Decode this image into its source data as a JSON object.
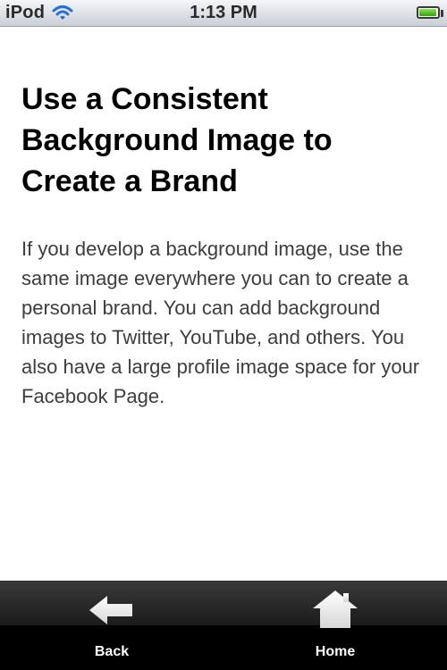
{
  "status_bar": {
    "carrier": "iPod",
    "time": "1:13 PM",
    "icons": {
      "wifi": "wifi-icon",
      "battery": "battery-icon"
    },
    "battery_level": 0.95,
    "colors": {
      "battery": "#2fa10e",
      "wifi": "#2a6fd6"
    }
  },
  "article": {
    "title": "Use a Consistent Background Image to Create a Brand",
    "body": "If you develop a background image, use the same image everywhere you can to create a personal brand. You can add background images to Twitter, YouTube, and others. You also have a large profile image space for your Facebook Page."
  },
  "tab_bar": {
    "back": {
      "label": "Back",
      "icon": "arrow-left-icon"
    },
    "home": {
      "label": "Home",
      "icon": "home-icon"
    }
  }
}
